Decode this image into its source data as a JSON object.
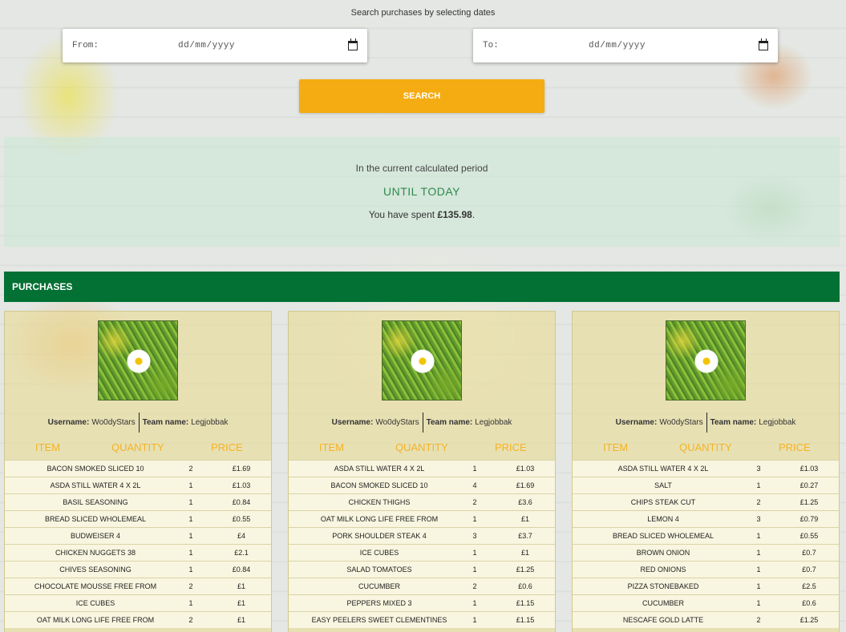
{
  "search": {
    "caption": "Search purchases by selecting dates",
    "from_label": "From:",
    "from_placeholder": "dd/mm/yyyy",
    "to_label": "To:",
    "to_placeholder": "dd/mm/yyyy",
    "button": "SEARCH"
  },
  "period": {
    "line1": "In the current calculated period",
    "line2": "UNTIL TODAY",
    "spent_prefix": "You have spent ",
    "spent_amount": "£135.98",
    "spent_suffix": "."
  },
  "purchases_title": "PURCHASES",
  "table_headers": {
    "item": "ITEM",
    "quantity": "QUANTITY",
    "price": "PRICE"
  },
  "cards": [
    {
      "username_label": "Username:",
      "username": "Wo0dyStars",
      "team_label": "Team name:",
      "team": "Legjobbak",
      "items": [
        {
          "name": "BACON SMOKED SLICED 10",
          "qty": "2",
          "price": "£1.69"
        },
        {
          "name": "ASDA STILL WATER 4 X 2L",
          "qty": "1",
          "price": "£1.03"
        },
        {
          "name": "BASIL SEASONING",
          "qty": "1",
          "price": "£0.84"
        },
        {
          "name": "BREAD SLICED WHOLEMEAL",
          "qty": "1",
          "price": "£0.55"
        },
        {
          "name": "BUDWEISER 4",
          "qty": "1",
          "price": "£4"
        },
        {
          "name": "CHICKEN NUGGETS 38",
          "qty": "1",
          "price": "£2.1"
        },
        {
          "name": "CHIVES SEASONING",
          "qty": "1",
          "price": "£0.84"
        },
        {
          "name": "CHOCOLATE MOUSSE FREE FROM",
          "qty": "2",
          "price": "£1"
        },
        {
          "name": "ICE CUBES",
          "qty": "1",
          "price": "£1"
        },
        {
          "name": "OAT MILK LONG LIFE FREE FROM",
          "qty": "2",
          "price": "£1"
        }
      ]
    },
    {
      "username_label": "Username:",
      "username": "Wo0dyStars",
      "team_label": "Team name:",
      "team": "Legjobbak",
      "items": [
        {
          "name": "ASDA STILL WATER 4 X 2L",
          "qty": "1",
          "price": "£1.03"
        },
        {
          "name": "BACON SMOKED SLICED 10",
          "qty": "4",
          "price": "£1.69"
        },
        {
          "name": "CHICKEN THIGHS",
          "qty": "2",
          "price": "£3.6"
        },
        {
          "name": "OAT MILK LONG LIFE FREE FROM",
          "qty": "1",
          "price": "£1"
        },
        {
          "name": "PORK SHOULDER STEAK 4",
          "qty": "3",
          "price": "£3.7"
        },
        {
          "name": "ICE CUBES",
          "qty": "1",
          "price": "£1"
        },
        {
          "name": "SALAD TOMATOES",
          "qty": "1",
          "price": "£1.25"
        },
        {
          "name": "CUCUMBER",
          "qty": "2",
          "price": "£0.6"
        },
        {
          "name": "PEPPERS MIXED 3",
          "qty": "1",
          "price": "£1.15"
        },
        {
          "name": "EASY PEELERS SWEET CLEMENTINES",
          "qty": "1",
          "price": "£1.15"
        }
      ]
    },
    {
      "username_label": "Username:",
      "username": "Wo0dyStars",
      "team_label": "Team name:",
      "team": "Legjobbak",
      "items": [
        {
          "name": "ASDA STILL WATER 4 X 2L",
          "qty": "3",
          "price": "£1.03"
        },
        {
          "name": "SALT",
          "qty": "1",
          "price": "£0.27"
        },
        {
          "name": "CHIPS STEAK CUT",
          "qty": "2",
          "price": "£1.25"
        },
        {
          "name": "LEMON 4",
          "qty": "3",
          "price": "£0.79"
        },
        {
          "name": "BREAD SLICED WHOLEMEAL",
          "qty": "1",
          "price": "£0.55"
        },
        {
          "name": "BROWN ONION",
          "qty": "1",
          "price": "£0.7"
        },
        {
          "name": "RED ONIONS",
          "qty": "1",
          "price": "£0.7"
        },
        {
          "name": "PIZZA STONEBAKED",
          "qty": "1",
          "price": "£2.5"
        },
        {
          "name": "CUCUMBER",
          "qty": "1",
          "price": "£0.6"
        },
        {
          "name": "NESCAFE GOLD LATTE",
          "qty": "2",
          "price": "£1.25"
        }
      ]
    }
  ]
}
